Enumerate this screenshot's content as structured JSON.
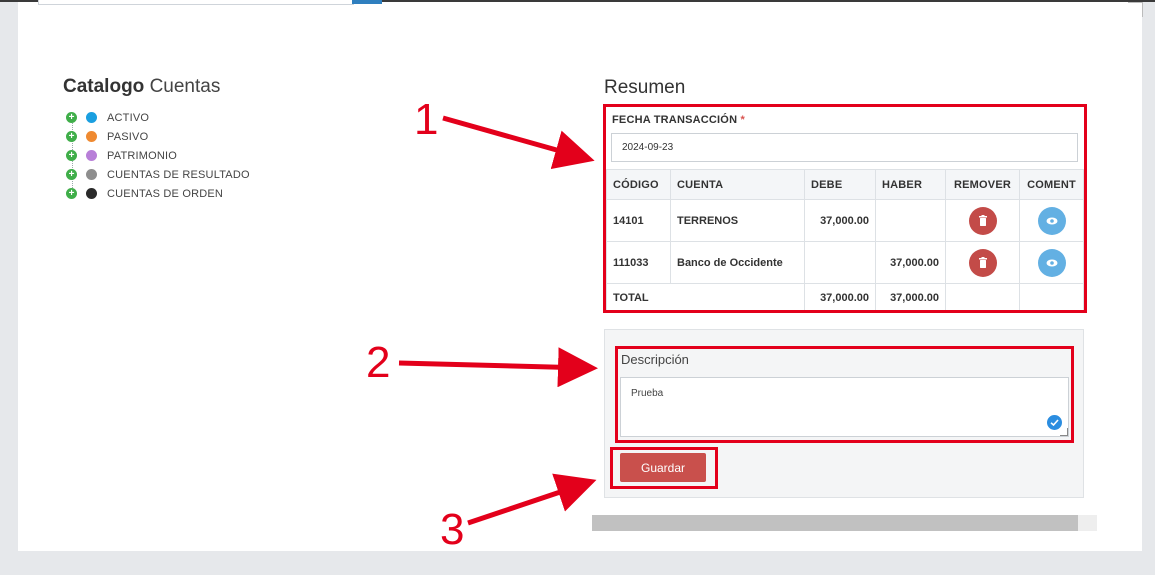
{
  "catalog": {
    "title_bold": "Catalogo",
    "title_light": "Cuentas",
    "items": [
      {
        "label": "ACTIVO",
        "color": "#1a9fe0"
      },
      {
        "label": "PASIVO",
        "color": "#ef8a31"
      },
      {
        "label": "PATRIMONIO",
        "color": "#b87fd8"
      },
      {
        "label": "CUENTAS DE RESULTADO",
        "color": "#8e8e8e"
      },
      {
        "label": "CUENTAS DE ORDEN",
        "color": "#2a2a2a"
      }
    ],
    "expand_symbol": "+"
  },
  "resumen": {
    "title": "Resumen",
    "fecha_label": "FECHA TRANSACCIÓN",
    "required_mark": "*",
    "fecha_value": "2024-09-23",
    "columns": [
      "CÓDIGO",
      "CUENTA",
      "DEBE",
      "HABER",
      "REMOVER",
      "COMENT"
    ],
    "rows": [
      {
        "codigo": "14101",
        "cuenta": "TERRENOS",
        "debe": "37,000.00",
        "haber": ""
      },
      {
        "codigo": "111033",
        "cuenta": "Banco de Occidente",
        "debe": "",
        "haber": "37,000.00"
      }
    ],
    "total": {
      "label": "TOTAL",
      "debe": "37,000.00",
      "haber": "37,000.00"
    }
  },
  "descripcion": {
    "label": "Descripción",
    "value": "Prueba"
  },
  "save_label": "Guardar",
  "annotations": [
    "1",
    "2",
    "3"
  ],
  "colors": {
    "annotation_red": "#e3001b",
    "delete_button": "#c34b48",
    "comment_button": "#63b0e3",
    "save_button": "#c9504c"
  }
}
